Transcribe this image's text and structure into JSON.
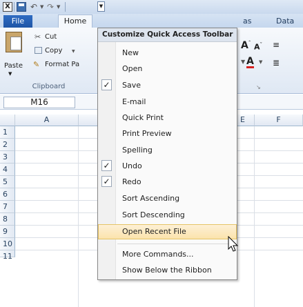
{
  "qat": {
    "excel_icon": "X",
    "save_icon": "save-icon",
    "undo_icon": "undo-icon",
    "redo_icon": "redo-icon"
  },
  "tabs": {
    "file": "File",
    "home": "Home",
    "partial_formulas": "as",
    "data": "Data"
  },
  "clipboard": {
    "paste": "Paste",
    "cut": "Cut",
    "copy": "Copy",
    "format_painter": "Format Pa",
    "group_label": "Clipboard"
  },
  "formula_bar": {
    "name_box": "M16"
  },
  "grid": {
    "columns": [
      "A",
      "E",
      "F"
    ],
    "rows": [
      "1",
      "2",
      "3",
      "4",
      "5",
      "6",
      "7",
      "8",
      "9",
      "10",
      "11"
    ]
  },
  "menu": {
    "title": "Customize Quick Access Toolbar",
    "items": [
      {
        "label": "New",
        "checked": false
      },
      {
        "label": "Open",
        "checked": false
      },
      {
        "label": "Save",
        "checked": true
      },
      {
        "label": "E-mail",
        "checked": false
      },
      {
        "label": "Quick Print",
        "checked": false
      },
      {
        "label": "Print Preview",
        "checked": false
      },
      {
        "label": "Spelling",
        "checked": false
      },
      {
        "label": "Undo",
        "checked": true
      },
      {
        "label": "Redo",
        "checked": true
      },
      {
        "label": "Sort Ascending",
        "checked": false
      },
      {
        "label": "Sort Descending",
        "checked": false
      },
      {
        "label": "Open Recent File",
        "checked": false,
        "hover": true
      },
      {
        "label": "More Commands...",
        "checked": false
      },
      {
        "label": "Show Below the Ribbon",
        "checked": false
      }
    ]
  },
  "colors": {
    "file_tab": "#2a62b8",
    "hover": "#fbe3ac"
  }
}
